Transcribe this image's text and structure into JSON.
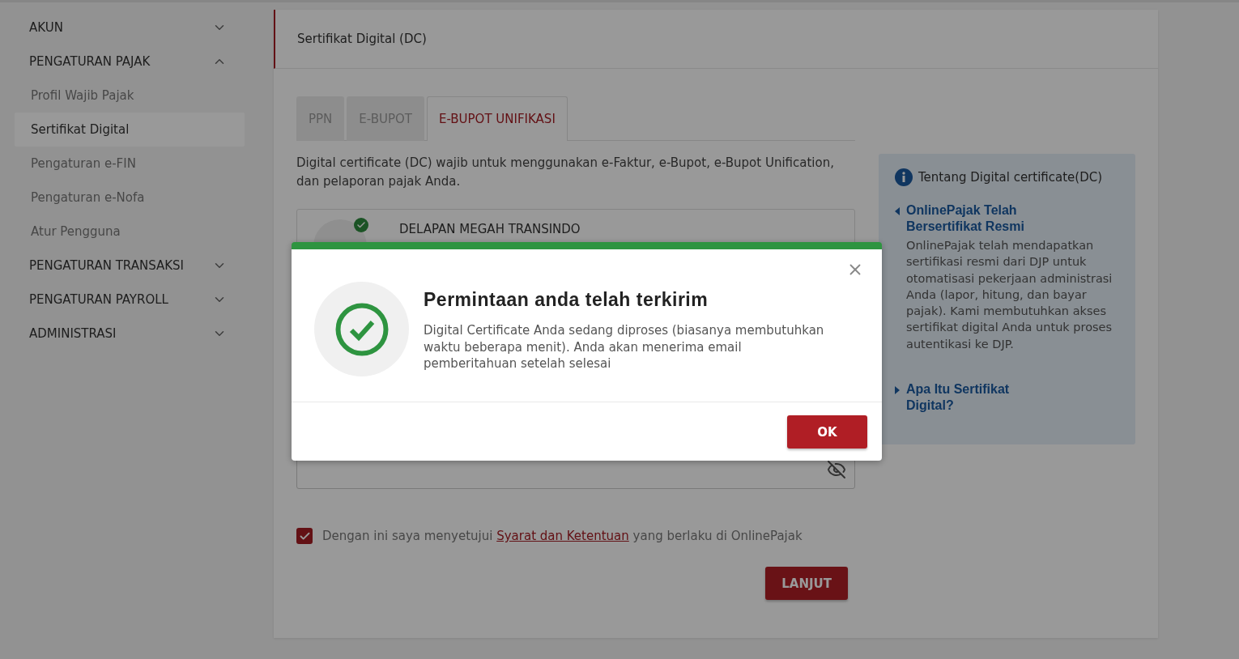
{
  "sidebar": {
    "sections": [
      {
        "label": "AKUN",
        "expanded": false
      },
      {
        "label": "PENGATURAN PAJAK",
        "expanded": true,
        "children": [
          {
            "label": "Profil Wajib Pajak",
            "selected": false
          },
          {
            "label": "Sertifikat Digital",
            "selected": true
          },
          {
            "label": "Pengaturan e-FIN",
            "selected": false
          },
          {
            "label": "Pengaturan e-Nofa",
            "selected": false
          },
          {
            "label": "Atur Pengguna",
            "selected": false
          }
        ]
      },
      {
        "label": "PENGATURAN TRANSAKSI",
        "expanded": false
      },
      {
        "label": "PENGATURAN PAYROLL",
        "expanded": false
      },
      {
        "label": "ADMINISTRASI",
        "expanded": false
      }
    ]
  },
  "header": {
    "title": "Sertifikat Digital (DC)"
  },
  "tabs": [
    {
      "label": "PPN",
      "selected": false
    },
    {
      "label": "E-BUPOT",
      "selected": false
    },
    {
      "label": "E-BUPOT UNIFIKASI",
      "selected": true
    }
  ],
  "description": "Digital certificate (DC) wajib untuk menggunakan e-Faktur, e-Bupot, e-Bupot Unification, dan pelaporan pajak Anda.",
  "company": {
    "name": "DELAPAN MEGAH TRANSINDO",
    "verified": true
  },
  "password_field": {
    "masked": true
  },
  "agreement": {
    "checked": true,
    "before": "Dengan ini saya menyetujui ",
    "link": "Syarat dan Ketentuan",
    "after": " yang berlaku di OnlinePajak"
  },
  "submit_button": "LANJUT",
  "info_panel": {
    "title": "Tentang Digital certificate(DC)",
    "sections": [
      {
        "title": "OnlinePajak Telah Bersertifikat Resmi",
        "expanded": true,
        "body": "OnlinePajak telah mendapatkan sertifikasi resmi dari DJP untuk otomatisasi pekerjaan administrasi Anda (lapor, hitung, dan bayar pajak). Kami membutuhkan akses sertifikat digital Anda untuk proses autentikasi ke DJP."
      },
      {
        "title": "Apa Itu Sertifikat Digital?",
        "expanded": false
      }
    ]
  },
  "modal": {
    "title": "Permintaan anda telah terkirim",
    "message": "Digital Certificate Anda sedang diproses (biasanya membutuhkan waktu beberapa menit). Anda akan menerima email pemberitahuan setelah selesai",
    "button": "OK"
  }
}
